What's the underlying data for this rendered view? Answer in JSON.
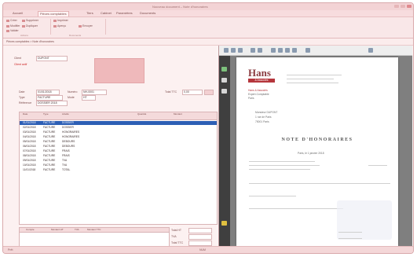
{
  "window": {
    "title": "Nouveau document – Note d'honoraires"
  },
  "menu": {
    "tabs": [
      "Accueil",
      "Pièces comptables",
      "Tiers",
      "Cabinet",
      "Paramètres",
      "Documents"
    ],
    "active": 1
  },
  "ribbon": {
    "buttons": [
      "Créer",
      "Supprimer",
      "Modifier",
      "Dupliquer",
      "Valider",
      "Imprimer",
      "Aperçu",
      "Envoyer"
    ],
    "groups": [
      "Actions",
      "Documents"
    ]
  },
  "subbar": {
    "text": "Pièces comptables > Note d'honoraires"
  },
  "form": {
    "client_label": "Client",
    "client_value": "DUPONT",
    "client_note": "Client actif",
    "date_label": "Date",
    "date_value": "01/01/2018",
    "numero_label": "Numéro",
    "numero_value": "NH-0001",
    "type_label": "Type",
    "type_value": "FACTURE",
    "ref_label": "Référence",
    "ref_value": "DOSSIER 2018",
    "total_label": "Total TTC",
    "total_value": "0,00",
    "mode_label": "Mode",
    "mode_value": "HT"
  },
  "grid": {
    "headers": [
      "Date",
      "Type",
      "Libellé",
      "Quantité",
      "Montant"
    ],
    "rows": [
      {
        "date": "01/01/2018",
        "type": "FACTURE",
        "lib": "DOSSIER",
        "q": "",
        "m": ""
      },
      {
        "date": "02/01/2018",
        "type": "FACTURE",
        "lib": "DOSSIER",
        "q": "",
        "m": ""
      },
      {
        "date": "03/01/2018",
        "type": "FACTURE",
        "lib": "HONORAIRES",
        "q": "",
        "m": ""
      },
      {
        "date": "04/01/2018",
        "type": "FACTURE",
        "lib": "HONORAIRES",
        "q": "",
        "m": ""
      },
      {
        "date": "05/01/2018",
        "type": "FACTURE",
        "lib": "DEBOURS",
        "q": "",
        "m": ""
      },
      {
        "date": "06/01/2018",
        "type": "FACTURE",
        "lib": "DEBOURS",
        "q": "",
        "m": ""
      },
      {
        "date": "07/01/2018",
        "type": "FACTURE",
        "lib": "FRAIS",
        "q": "",
        "m": ""
      },
      {
        "date": "08/01/2018",
        "type": "FACTURE",
        "lib": "FRAIS",
        "q": "",
        "m": ""
      },
      {
        "date": "09/01/2018",
        "type": "FACTURE",
        "lib": "TVA",
        "q": "",
        "m": ""
      },
      {
        "date": "10/01/2018",
        "type": "FACTURE",
        "lib": "TVA",
        "q": "",
        "m": ""
      },
      {
        "date": "11/01/2018",
        "type": "FACTURE",
        "lib": "TOTAL",
        "q": "",
        "m": ""
      }
    ]
  },
  "recap": {
    "headers": [
      "Compte",
      "Montant HT",
      "TVA",
      "Montant TTC"
    ]
  },
  "totals": {
    "ht_label": "Total HT",
    "tva_label": "TVA",
    "ttc_label": "Total TTC"
  },
  "pdf": {
    "logo": "Hans",
    "logo_sub": "& Associés",
    "header_lines": [
      "Hans & Associés",
      "Expert-Comptable",
      "Paris"
    ],
    "client_lines": [
      "Monsieur DUPONT",
      "1 rue de Paris",
      "75001 Paris"
    ],
    "title": "NOTE D'HONORAIRES",
    "date_line": "Paris, le 1 janvier 2018"
  },
  "statusbar": {
    "left": "Prêt",
    "right": "NUM"
  }
}
